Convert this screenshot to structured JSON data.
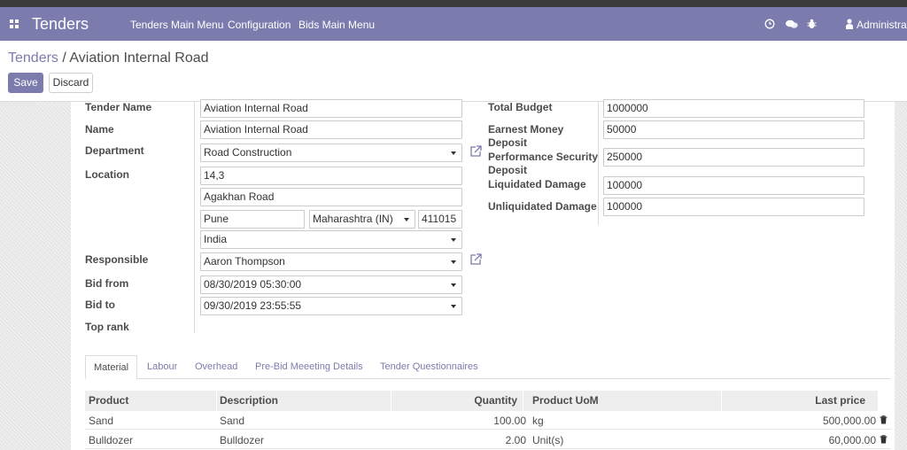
{
  "nav": {
    "brand": "Tenders",
    "menu": [
      "Tenders Main Menu",
      "Configuration",
      "Bids Main Menu"
    ],
    "user": "Administrat"
  },
  "breadcrumb": {
    "parent": "Tenders",
    "sep": " / ",
    "current": "Aviation Internal Road"
  },
  "buttons": {
    "save": "Save",
    "discard": "Discard"
  },
  "form": {
    "tender_name": {
      "label": "Tender Name",
      "value": "Aviation Internal Road"
    },
    "name": {
      "label": "Name",
      "value": "Aviation Internal Road"
    },
    "department": {
      "label": "Department",
      "value": "Road Construction"
    },
    "location": {
      "label": "Location",
      "street": "14,3",
      "street2": "Agakhan Road",
      "city": "Pune",
      "state": "Maharashtra (IN)",
      "zip": "411015",
      "country": "India"
    },
    "responsible": {
      "label": "Responsible",
      "value": "Aaron Thompson"
    },
    "bid_from": {
      "label": "Bid from",
      "value": "08/30/2019 05:30:00"
    },
    "bid_to": {
      "label": "Bid to",
      "value": "09/30/2019 23:55:55"
    },
    "top_rank": {
      "label": "Top rank"
    },
    "total_budget": {
      "label": "Total Budget",
      "value": "1000000"
    },
    "earnest_money": {
      "label1": "Earnest Money",
      "label2": "Deposit",
      "value": "50000"
    },
    "performance_security": {
      "label1": "Performance Security",
      "label2": "Deposit",
      "value": "250000"
    },
    "liquidated_damage": {
      "label": "Liquidated Damage",
      "value": "100000"
    },
    "unliquidated_damage": {
      "label": "Unliquidated Damage",
      "value": "100000"
    }
  },
  "tabs": [
    "Material",
    "Labour",
    "Overhead",
    "Pre-Bid Meeeting Details",
    "Tender Questionnaires"
  ],
  "table": {
    "headers": {
      "product": "Product",
      "description": "Description",
      "quantity": "Quantity",
      "uom": "Product UoM",
      "last_price": "Last price"
    },
    "rows": [
      {
        "product": "Sand",
        "description": "Sand",
        "quantity": "100.00",
        "uom": "kg",
        "last_price": "500,000.00"
      },
      {
        "product": "Bulldozer",
        "description": "Bulldozer",
        "quantity": "2.00",
        "uom": "Unit(s)",
        "last_price": "60,000.00"
      }
    ]
  },
  "colors": {
    "brand": "#7c7bad",
    "topbar": "#3b3b3b"
  },
  "icons": [
    "apps-grid-icon",
    "clock-icon",
    "chat-icon",
    "bug-icon",
    "user-icon",
    "external-link-icon",
    "trash-icon",
    "dropdown-caret-icon"
  ]
}
